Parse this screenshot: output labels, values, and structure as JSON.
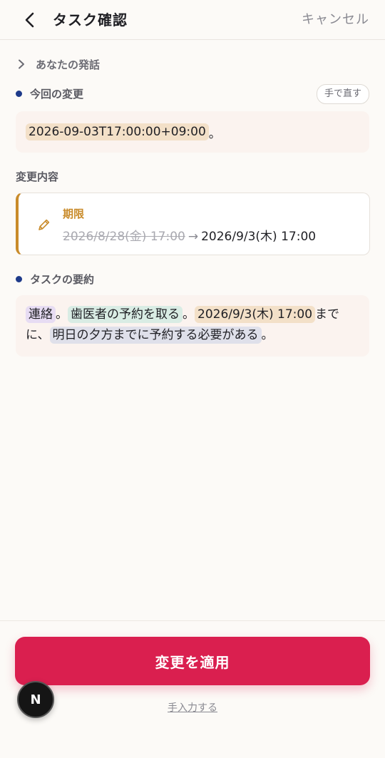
{
  "header": {
    "title": "タスク確認",
    "cancel_label": "キャンセル"
  },
  "utterance": {
    "toggle_label": "あなたの発話"
  },
  "current_change": {
    "label": "今回の変更",
    "fix_button": "手で直す",
    "value": "2026-09-03T17:00:00+09:00",
    "suffix": "。"
  },
  "change_details": {
    "label": "変更内容",
    "field_name": "期限",
    "old_value": "2026/8/28(金) 17:00",
    "arrow": "→",
    "new_value": "2026/9/3(木) 17:00"
  },
  "summary": {
    "label": "タスクの要約",
    "category": "連絡",
    "sep1": "。",
    "task": "歯医者の予約を取る",
    "sep2": "。",
    "deadline": "2026/9/3(木) 17:00",
    "text_after_deadline": "まで",
    "text_line2_prefix": "に、",
    "description": "明日の夕方までに予約する必要がある",
    "end": "。"
  },
  "footer": {
    "apply_button": "変更を適用",
    "manual_link": "手入力する",
    "badge_letter": "N"
  },
  "colors": {
    "accent": "#da1f4f",
    "deadline_accent": "#c98b2a",
    "dot": "#1e3a8a"
  }
}
